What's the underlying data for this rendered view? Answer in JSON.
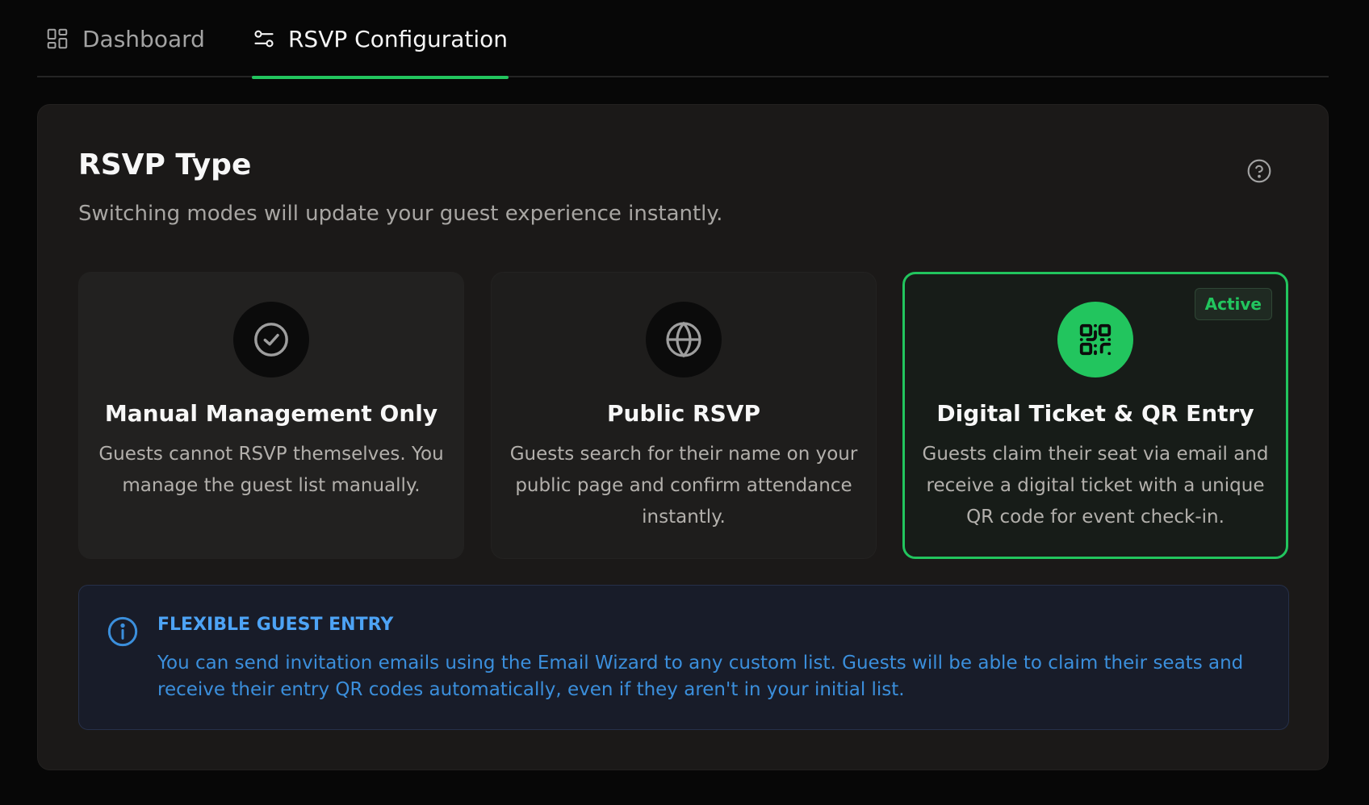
{
  "tabs": {
    "dashboard": {
      "label": "Dashboard",
      "icon": "dashboard-grid-icon"
    },
    "rsvp": {
      "label": "RSVP Configuration",
      "icon": "sliders-icon",
      "active": true
    }
  },
  "rsvp_type": {
    "title": "RSVP Type",
    "subtitle": "Switching modes will update your guest experience instantly.",
    "help_icon": "question-circle-icon",
    "options": [
      {
        "title": "Manual Management Only",
        "description": "Guests cannot RSVP themselves. You manage the guest list manually.",
        "icon": "check-circle-icon"
      },
      {
        "title": "Public RSVP",
        "description": "Guests search for their name on your public page and confirm attendance instantly.",
        "icon": "globe-icon"
      },
      {
        "title": "Digital Ticket & QR Entry",
        "description": "Guests claim their seat via email and receive a digital ticket with a unique QR code for event check-in.",
        "icon": "qr-code-icon",
        "badge": "Active",
        "selected": true
      }
    ]
  },
  "info": {
    "icon": "info-icon",
    "title": "FLEXIBLE GUEST ENTRY",
    "text": "You can send invitation emails using the Email Wizard to any custom list. Guests will be able to claim their seats and receive their entry QR codes automatically, even if they aren't in your initial list."
  },
  "colors": {
    "accent": "#22c55e",
    "info": "#3b8fdc",
    "background": "#070707",
    "panel": "#1b1918"
  }
}
